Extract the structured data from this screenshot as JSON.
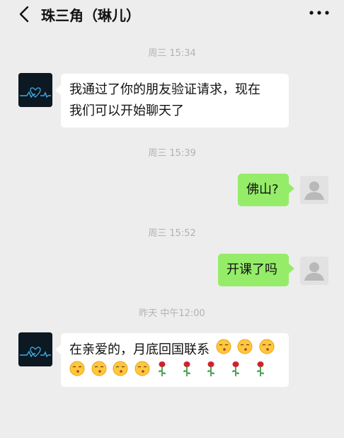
{
  "header": {
    "title": "珠三角（琳儿）"
  },
  "messages": [
    {
      "time": "周三 15:34",
      "side": "left",
      "lines": [
        "我通过了你的朋友验证请求，现在",
        "我们可以开始聊天了"
      ]
    },
    {
      "time": "周三 15:39",
      "side": "right",
      "text": "佛山?"
    },
    {
      "time": "周三 15:52",
      "side": "right",
      "text": "开课了吗"
    },
    {
      "time": "昨天 中午12:00",
      "side": "left",
      "text": "在亲爱的，月底回国联系",
      "emoji_line1": [
        "kissing-closed-eyes",
        "kissing-closed-eyes",
        "kissing-closed-eyes"
      ],
      "emoji_line2": [
        "kissing-closed-eyes",
        "kissing-closed-eyes",
        "kissing-closed-eyes",
        "kissing-closed-eyes",
        "rose",
        "rose",
        "rose",
        "rose",
        "rose"
      ]
    }
  ],
  "colors": {
    "background": "#ededed",
    "bubble_self": "#95ec69",
    "bubble_other": "#ffffff",
    "timestamp": "#b2b2b2"
  },
  "icons": {
    "back": "chevron-left-icon",
    "more": "more-dots-icon",
    "avatar_contact": "heartbeat-avatar",
    "avatar_self": "default-user-avatar"
  }
}
